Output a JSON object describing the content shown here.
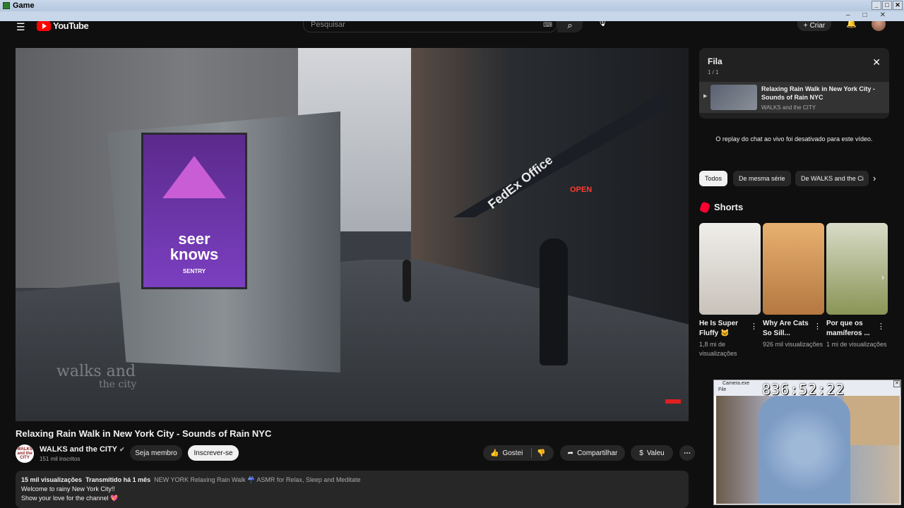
{
  "window": {
    "title": "Game",
    "controls": [
      "_",
      "□",
      "✕"
    ]
  },
  "masthead": {
    "logo_text": "YouTube",
    "search_placeholder": "Pesquisar",
    "create_label": "Criar"
  },
  "video": {
    "title": "Relaxing Rain Walk in New York City - Sounds of Rain NYC",
    "ad_text_1": "seer",
    "ad_text_2": "knows",
    "ad_brand": "SENTRY",
    "store_sign": "FedEx Office",
    "open_sign": "OPEN",
    "watermark_1": "walks and",
    "watermark_2": "the city"
  },
  "channel": {
    "avatar_text": "WALKS and the CITY",
    "name": "WALKS and the CITY",
    "subscribers": "151 mil inscritos",
    "member_label": "Seja membro",
    "subscribe_label": "Inscrever-se"
  },
  "actions": {
    "like_label": "Gostei",
    "share_label": "Compartilhar",
    "thanks_label": "Valeu"
  },
  "description": {
    "views": "15 mil visualizações",
    "streamed": "Transmitido há 1 mês",
    "tags": "NEW YORK Relaxing Rain Walk ☔ ASMR for Relax, Sleep and Meditate",
    "line1": "Welcome to rainy New York City!!",
    "line2": "Show your love for the channel 💖"
  },
  "queue": {
    "title": "Fila",
    "count": "1 / 1",
    "item_title": "Relaxing Rain Walk in New York City - Sounds of Rain NYC",
    "item_channel": "WALKS and the CITY"
  },
  "chat_disabled": "O replay do chat ao vivo foi desativado para este vídeo.",
  "chips": [
    "Todos",
    "De mesma série",
    "De WALKS and the Ci"
  ],
  "shorts": {
    "header": "Shorts",
    "items": [
      {
        "title": "He Is Super Fluffy 🐱",
        "views": "1,8 mi de visualizações",
        "color": "#d8d4d0"
      },
      {
        "title": "Why Are Cats So Sill...",
        "views": "926 mil visualizações",
        "color": "#c8955a"
      },
      {
        "title": "Por que os mamíferos ...",
        "views": "1 mi de visualizações",
        "color": "#a6b07a"
      }
    ]
  },
  "pip": {
    "title": "Camera.exe",
    "menu": "File",
    "timer": "836:52:22"
  }
}
